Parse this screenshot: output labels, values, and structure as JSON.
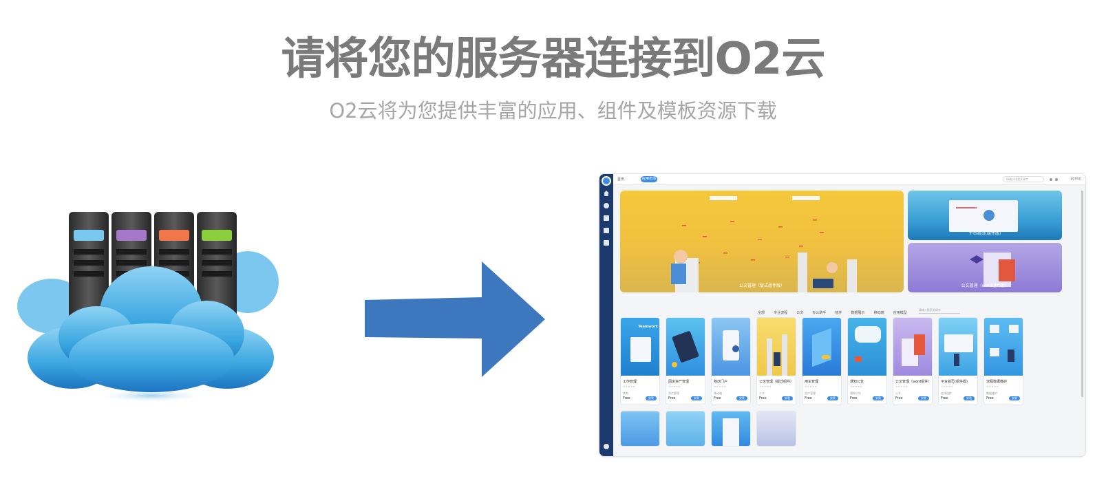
{
  "heading": "请将您的服务器连接到O2云",
  "subheading": "O2云将为您提供丰富的应用、组件及模板资源下载",
  "colors": {
    "title": "#7a7a7a",
    "subtitle": "#a6a6a6",
    "arrow": "#3d78be",
    "accent": "#3c8ce7",
    "sidebar": "#1c3a6b"
  },
  "screenshot": {
    "topbar": {
      "home_label": "首页",
      "active_tab": "应用市场",
      "search_placeholder": "请输入搜索关键字",
      "user": "admin"
    },
    "banner_main_caption": "公文管理（版式组件版）",
    "banner_side": [
      {
        "caption": "平台首页(组件版)"
      },
      {
        "caption": "公文管理（word组件版）"
      }
    ],
    "filters": [
      "全部",
      "专业流程",
      "公文",
      "办公助手",
      "插件",
      "数据展示",
      "移动端",
      "应用模型"
    ],
    "filter_search_placeholder": "请输入搜索关键字",
    "cards": [
      {
        "name": "工作管理",
        "category": "其他",
        "price": "Free",
        "button": "安装",
        "art": "teamwork"
      },
      {
        "name": "固定资产管理",
        "category": "资产管理",
        "price": "Free",
        "button": "安装",
        "art": "assets"
      },
      {
        "name": "移动门户",
        "category": "移动端",
        "price": "Free",
        "button": "安装",
        "art": "mobile"
      },
      {
        "name": "公文管理（版式组件）",
        "category": "公文",
        "price": "Free",
        "button": "安装",
        "art": "docs"
      },
      {
        "name": "用车管理",
        "category": "资产管理",
        "price": "Free",
        "button": "安装",
        "art": "car"
      },
      {
        "name": "通知公告",
        "category": "通知公告",
        "price": "Free",
        "button": "安装",
        "art": "notice"
      },
      {
        "name": "公文管理（word组件）",
        "category": "公文",
        "price": "Free",
        "button": "安装",
        "art": "word"
      },
      {
        "name": "平台首页(组件版)",
        "category": "在线组件",
        "price": "Free",
        "button": "安装",
        "art": "portal"
      },
      {
        "name": "流程数据维护",
        "category": "数据维护",
        "price": "Free",
        "button": "安装",
        "art": "flow"
      }
    ],
    "teamwork_label": "Teamwork",
    "stars": "★★★★★"
  }
}
